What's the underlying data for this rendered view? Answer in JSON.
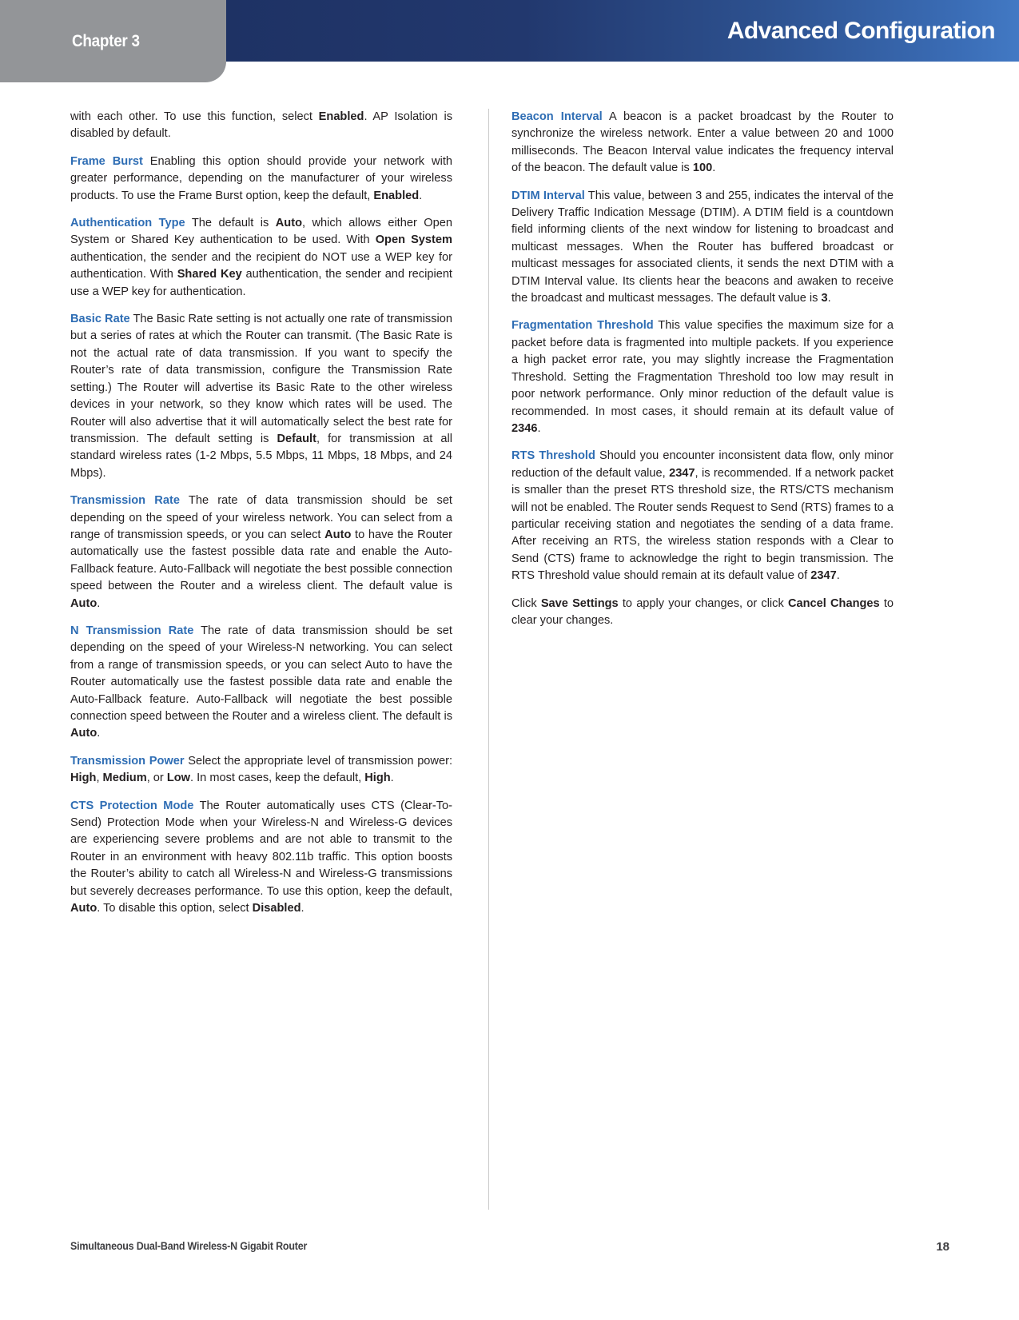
{
  "header": {
    "chapter_label": "Chapter 3",
    "title": "Advanced Configuration",
    "band_color_start": "#1e3264",
    "band_color_end": "#4279c4",
    "tab_color": "#939598"
  },
  "theme": {
    "term_color": "#2e6db4",
    "text_color": "#231f20",
    "divider_color": "#c9c9c9"
  },
  "left_column": {
    "paragraphs": [
      {
        "id": "ap-isolation-cont",
        "term": "",
        "runs": [
          {
            "t": "with each other. To use this function, select ",
            "s": "n"
          },
          {
            "t": "Enabled",
            "s": "b"
          },
          {
            "t": ". AP Isolation is disabled by default.",
            "s": "n"
          }
        ]
      },
      {
        "id": "frame-burst",
        "term": "Frame Burst",
        "runs": [
          {
            "t": " Enabling this option should provide your network with greater performance, depending on the manufacturer of your wireless products. To use the Frame Burst option, keep the default, ",
            "s": "n"
          },
          {
            "t": "Enabled",
            "s": "b"
          },
          {
            "t": ".",
            "s": "n"
          }
        ]
      },
      {
        "id": "authentication-type",
        "term": "Authentication Type",
        "runs": [
          {
            "t": "  The default is ",
            "s": "n"
          },
          {
            "t": "Auto",
            "s": "b"
          },
          {
            "t": ", which allows either Open System or Shared Key authentication to be used. With ",
            "s": "n"
          },
          {
            "t": "Open System",
            "s": "b"
          },
          {
            "t": " authentication, the sender and the recipient do NOT use a WEP key for authentication. With ",
            "s": "n"
          },
          {
            "t": "Shared Key",
            "s": "b"
          },
          {
            "t": " authentication, the sender and recipient use a WEP key for authentication.",
            "s": "n"
          }
        ]
      },
      {
        "id": "basic-rate",
        "term": "Basic Rate",
        "runs": [
          {
            "t": "  The Basic Rate setting is not actually one rate of transmission but a series of rates at which the Router can transmit. (The Basic Rate is not the actual rate of data transmission. If you want to specify the Router’s rate of data transmission, configure the Transmission Rate setting.) The Router will advertise its Basic Rate to the other wireless devices in your network, so they know which rates will be used. The Router will also advertise that it will automatically select the best rate for transmission. The default setting is ",
            "s": "n"
          },
          {
            "t": "Default",
            "s": "b"
          },
          {
            "t": ", for transmission at all standard wireless rates (1-2 Mbps, 5.5 Mbps, 11 Mbps, 18 Mbps, and 24 Mbps).",
            "s": "n"
          }
        ]
      },
      {
        "id": "transmission-rate",
        "term": "Transmission Rate",
        "runs": [
          {
            "t": "  The rate of data transmission should be set depending on the speed of your wireless network. You can select from a range of transmission speeds, or you can select ",
            "s": "n"
          },
          {
            "t": "Auto",
            "s": "b"
          },
          {
            "t": " to have the Router automatically use the fastest possible data rate and enable the Auto-Fallback feature. Auto-Fallback will negotiate the best possible connection speed between the Router and a wireless client. The default value is ",
            "s": "n"
          },
          {
            "t": "Auto",
            "s": "b"
          },
          {
            "t": ".",
            "s": "n"
          }
        ]
      },
      {
        "id": "n-transmission-rate",
        "term": "N Transmission Rate",
        "runs": [
          {
            "t": " The rate of data transmission should be set depending on the speed of your Wireless-N networking. You can select from a range of transmission speeds, or you can select Auto to have the Router automatically use the fastest possible data rate and enable the Auto-Fallback feature. Auto-Fallback will negotiate the best possible connection speed between the Router and a wireless client. The default is ",
            "s": "n"
          },
          {
            "t": "Auto",
            "s": "b"
          },
          {
            "t": ".",
            "s": "n"
          }
        ]
      },
      {
        "id": "transmission-power",
        "term": "Transmission Power",
        "runs": [
          {
            "t": " Select the appropriate level of transmission power: ",
            "s": "n"
          },
          {
            "t": "High",
            "s": "b"
          },
          {
            "t": ", ",
            "s": "n"
          },
          {
            "t": "Medium",
            "s": "b"
          },
          {
            "t": ", or ",
            "s": "n"
          },
          {
            "t": "Low",
            "s": "b"
          },
          {
            "t": ". In most cases, keep the default, ",
            "s": "n"
          },
          {
            "t": "High",
            "s": "b"
          },
          {
            "t": ".",
            "s": "n"
          }
        ]
      },
      {
        "id": "cts-protection-mode",
        "term": "CTS Protection Mode",
        "runs": [
          {
            "t": " The Router automatically uses CTS (Clear-To-Send) Protection Mode when your Wireless-N and Wireless-G devices are experiencing severe problems and are not able to transmit to the Router in an environment with heavy 802.11b traffic. This option boosts the Router’s ability to catch all Wireless-N and Wireless-G transmissions but severely decreases performance. To use this option, keep the default, ",
            "s": "n"
          },
          {
            "t": "Auto",
            "s": "b"
          },
          {
            "t": ". To disable this option, select ",
            "s": "n"
          },
          {
            "t": "Disabled",
            "s": "b"
          },
          {
            "t": ".",
            "s": "n"
          }
        ]
      }
    ]
  },
  "right_column": {
    "paragraphs": [
      {
        "id": "beacon-interval",
        "term": "Beacon Interval",
        "runs": [
          {
            "t": "  A beacon is a packet broadcast by the Router to synchronize the wireless network. Enter a value between 20 and 1000 milliseconds. The Beacon Interval value indicates the frequency interval of the beacon. The default value is ",
            "s": "n"
          },
          {
            "t": "100",
            "s": "b"
          },
          {
            "t": ".",
            "s": "n"
          }
        ]
      },
      {
        "id": "dtim-interval",
        "term": "DTIM Interval",
        "runs": [
          {
            "t": "  This value, between 3 and 255, indicates the interval of the Delivery Traffic Indication Message (DTIM). A DTIM field is a countdown field informing clients of the next window for listening to broadcast and multicast messages. When the Router has buffered broadcast or multicast messages for associated clients, it sends the next DTIM with a DTIM Interval value. Its clients hear the beacons and awaken to receive the broadcast and multicast messages. The default value is ",
            "s": "n"
          },
          {
            "t": "3",
            "s": "b"
          },
          {
            "t": ".",
            "s": "n"
          }
        ]
      },
      {
        "id": "fragmentation-threshold",
        "term": "Fragmentation Threshold",
        "runs": [
          {
            "t": " This value specifies the maximum size for a packet before data is fragmented into multiple packets. If you experience a high packet error rate, you may slightly increase the Fragmentation Threshold. Setting the Fragmentation Threshold too low may result in poor network performance. Only minor reduction of the default value is recommended. In most cases, it should remain at its default value of ",
            "s": "n"
          },
          {
            "t": "2346",
            "s": "b"
          },
          {
            "t": ".",
            "s": "n"
          }
        ]
      },
      {
        "id": "rts-threshold",
        "term": "RTS Threshold",
        "runs": [
          {
            "t": "  Should you encounter inconsistent data flow, only minor reduction of the default value, ",
            "s": "n"
          },
          {
            "t": "2347",
            "s": "b"
          },
          {
            "t": ", is recommended. If a network packet is smaller than the preset RTS threshold size, the RTS/CTS mechanism will not be enabled. The Router sends Request to Send (RTS) frames to a particular receiving station and negotiates the sending of a data frame. After receiving an RTS, the wireless station responds with a Clear to Send (CTS) frame to acknowledge the right to begin transmission. The RTS Threshold value should remain at its default value of ",
            "s": "n"
          },
          {
            "t": "2347",
            "s": "b"
          },
          {
            "t": ".",
            "s": "n"
          }
        ]
      },
      {
        "id": "save-settings-note",
        "term": "",
        "runs": [
          {
            "t": "Click ",
            "s": "n"
          },
          {
            "t": "Save Settings",
            "s": "b"
          },
          {
            "t": " to apply your changes, or click ",
            "s": "n"
          },
          {
            "t": "Cancel Changes",
            "s": "b"
          },
          {
            "t": " to clear your changes.",
            "s": "n"
          }
        ]
      }
    ]
  },
  "footer": {
    "product_name": "Simultaneous Dual-Band Wireless-N Gigabit Router",
    "page_number": "18"
  }
}
